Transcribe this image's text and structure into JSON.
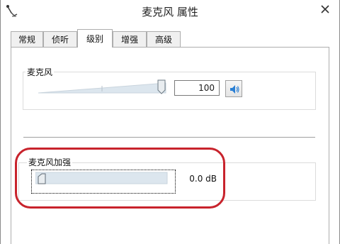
{
  "window": {
    "title": "麦克风 属性",
    "icon": "microphone-app-icon",
    "close_icon": "close-icon"
  },
  "tabs": [
    {
      "label": "常规",
      "active": false
    },
    {
      "label": "侦听",
      "active": false
    },
    {
      "label": "级别",
      "active": true
    },
    {
      "label": "增强",
      "active": false
    },
    {
      "label": "高级",
      "active": false
    }
  ],
  "microphone": {
    "label": "麦克风",
    "value": "100",
    "level_fraction": 1.0,
    "mute_icon": "speaker-icon"
  },
  "boost": {
    "label": "麦克风加强",
    "value": "0.0 dB",
    "level_fraction": 0.0
  },
  "colors": {
    "highlight": "#c8232c",
    "slider_fill": "#dce6ee",
    "speaker_blue": "#2a7fd4"
  }
}
